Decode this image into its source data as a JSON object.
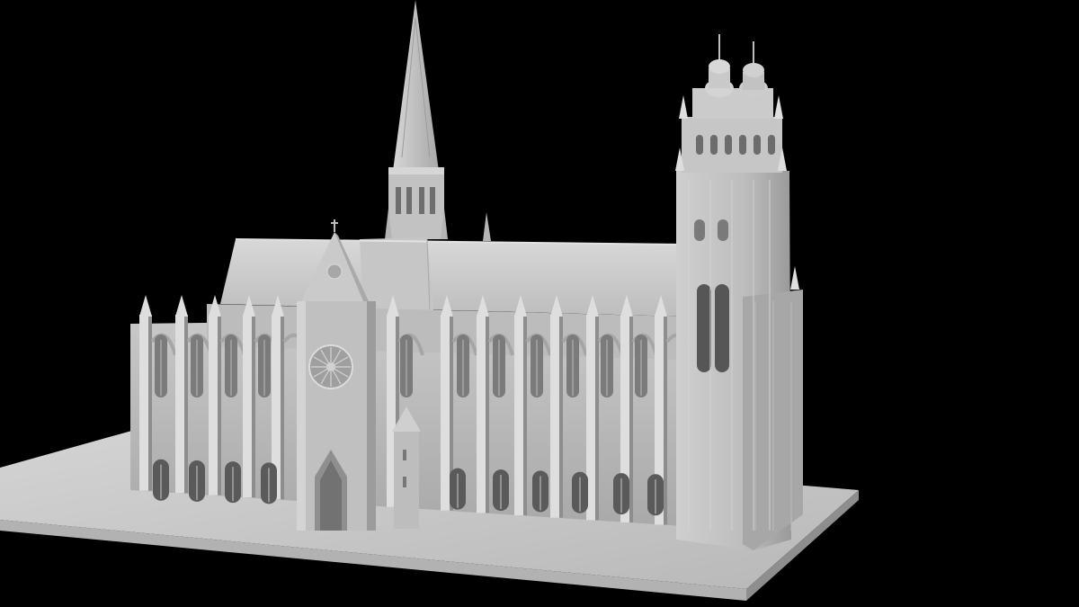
{
  "scene": {
    "subject": "cathedral-model-render",
    "colors": {
      "background": "#000000",
      "plinth_top": "#c9c9c9",
      "plinth_front": "#b2b2b2",
      "plinth_side": "#8e8e8e",
      "roof": "#cfcfcf",
      "roof_shade": "#b9b9b9",
      "wall": "#c4c4c4",
      "wall_shade": "#a6a6a6",
      "wall_dark": "#8d8d8d",
      "highlight": "#dedede",
      "window": "#7b7b7b",
      "window_deep": "#5a5a5a",
      "tower_glass": "#565656"
    }
  }
}
